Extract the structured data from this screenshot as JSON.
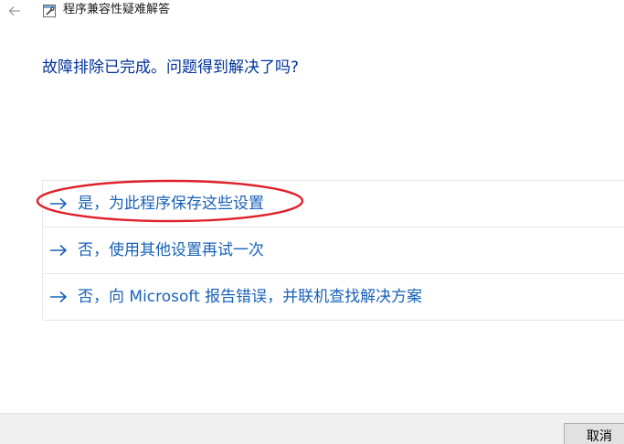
{
  "header": {
    "back_icon": "back-arrow-icon",
    "app_icon": "troubleshooter-icon",
    "title": "程序兼容性疑难解答"
  },
  "main": {
    "question": "故障排除已完成。问题得到解决了吗?",
    "options": [
      {
        "label": "是，为此程序保存这些设置",
        "icon": "arrow-right-icon",
        "highlighted": true
      },
      {
        "label": "否，使用其他设置再试一次",
        "icon": "arrow-right-icon"
      },
      {
        "label": "否，向 Microsoft 报告错误，并联机查找解决方案",
        "icon": "arrow-right-icon"
      }
    ]
  },
  "footer": {
    "cancel_label": "取消"
  },
  "colors": {
    "question": "#003399",
    "link": "#1a62b8",
    "highlight_ellipse": "#e0202a",
    "footer_bg": "#f0f0f0"
  }
}
